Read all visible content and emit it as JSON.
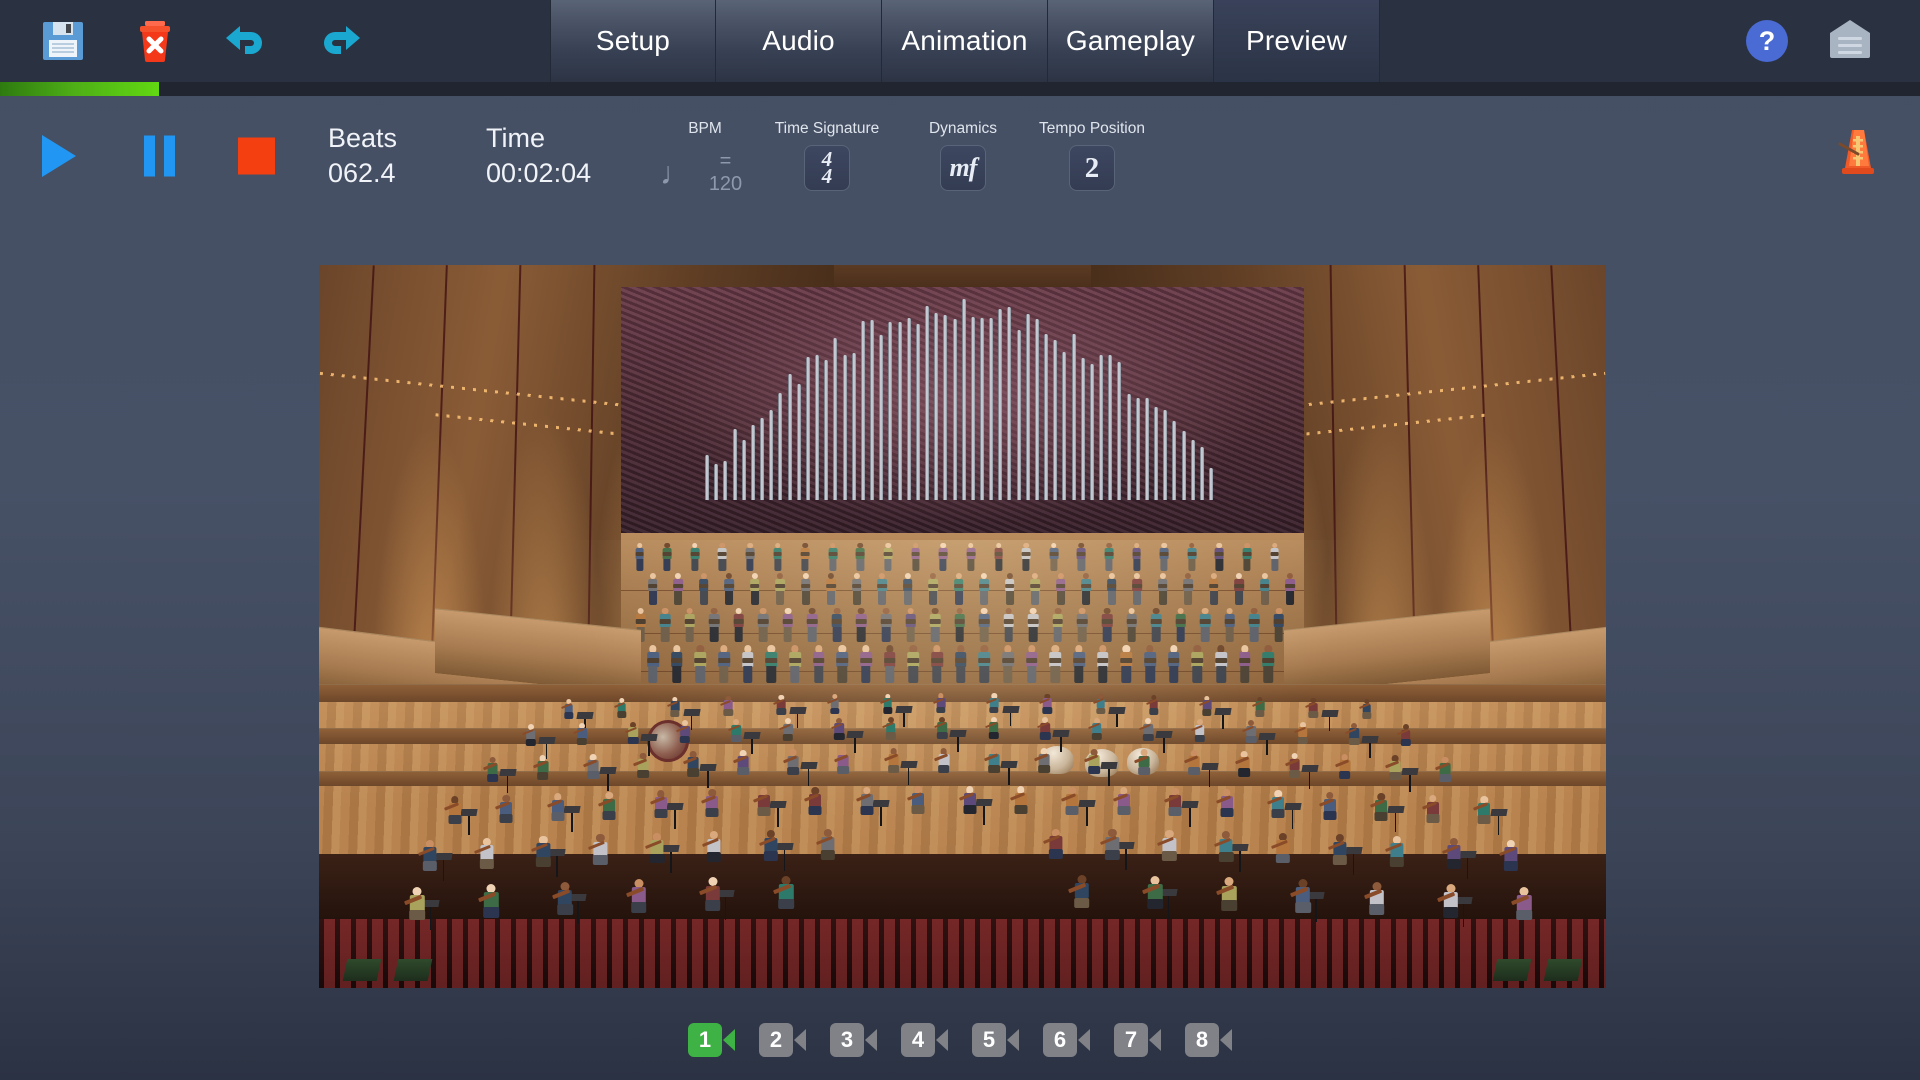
{
  "toolbar": {
    "icons": [
      {
        "name": "save-icon",
        "label": "Save"
      },
      {
        "name": "delete-icon",
        "label": "Delete"
      },
      {
        "name": "undo-icon",
        "label": "Undo"
      },
      {
        "name": "redo-icon",
        "label": "Redo"
      }
    ],
    "tabs": [
      {
        "label": "Setup",
        "active": false
      },
      {
        "label": "Audio",
        "active": false
      },
      {
        "label": "Animation",
        "active": false
      },
      {
        "label": "Gameplay",
        "active": false
      },
      {
        "label": "Preview",
        "active": true
      }
    ],
    "help_label": "?",
    "menu_label": ""
  },
  "progress": {
    "percent": 8.3,
    "fill_color_start": "#2e7a10",
    "fill_color_end": "#62d812",
    "track_color": "#20252f"
  },
  "transport": {
    "play_label": "Play",
    "pause_label": "Pause",
    "stop_label": "Stop",
    "metronome_label": "Metronome"
  },
  "readouts": {
    "beats_label": "Beats",
    "beats_value": "062.4",
    "time_label": "Time",
    "time_value": "00:02:04"
  },
  "meta": {
    "bpm_label": "BPM",
    "bpm_note": "♩",
    "bpm_value": "= 120",
    "time_signature_label": "Time Signature",
    "time_signature_top": "4",
    "time_signature_bottom": "4",
    "dynamics_label": "Dynamics",
    "dynamics_value": "mf",
    "tempo_position_label": "Tempo Position",
    "tempo_position_value": "2"
  },
  "viewport": {
    "scene": "concert-hall-orchestra-choir",
    "description": "3D rendered concert hall with orchestra on stage, choir on risers, pipe organ rear wall, conductor podium front center"
  },
  "cameras": {
    "items": [
      {
        "number": "1",
        "active": true
      },
      {
        "number": "2",
        "active": false
      },
      {
        "number": "3",
        "active": false
      },
      {
        "number": "4",
        "active": false
      },
      {
        "number": "5",
        "active": false
      },
      {
        "number": "6",
        "active": false
      },
      {
        "number": "7",
        "active": false
      },
      {
        "number": "8",
        "active": false
      }
    ],
    "active_color": "#3eb244",
    "inactive_color": "#808287"
  }
}
